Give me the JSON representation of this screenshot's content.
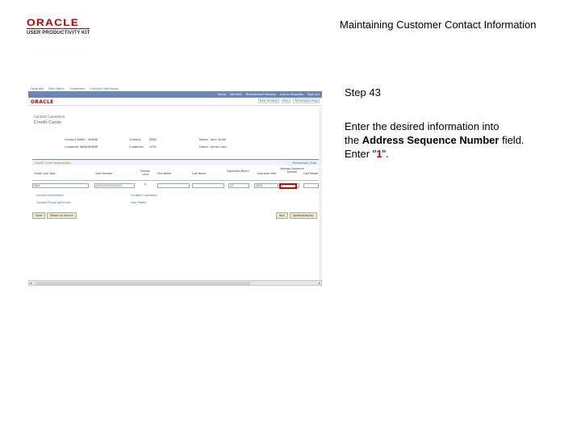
{
  "header": {
    "logo_brand": "ORACLE",
    "logo_sub": "USER PRODUCTIVITY KIT",
    "title": "Maintaining Customer Contact Information"
  },
  "instruction": {
    "step": "Step 43",
    "line1": "Enter the desired information into",
    "line2_pre": "the ",
    "field_name": "Address Sequence Number",
    "line2_post": " field.",
    "enter_pre": "Enter \"",
    "value": "1",
    "enter_post": "\"."
  },
  "screenshot": {
    "nav_top": [
      "Favorites",
      "Main Menu",
      "Customers",
      "Contact Information"
    ],
    "nav_links": [
      "Home",
      "Worklist",
      "Performance Monitor",
      "Add to Favorites",
      "Sign out"
    ],
    "brand": "ORACLE",
    "top_links": [
      "New Window",
      "Help",
      "Personalize Page"
    ],
    "breadcrumb": "Contact Customers",
    "page_title": "Credit Cards",
    "info": {
      "contact_setid_label": "Contact SetID:",
      "contact_setid": "SHARE",
      "contact_label": "Contact:",
      "contact": "NEW",
      "name_label1": "Name:",
      "name1": "John Smith",
      "customer_setid_label": "Customer SetID:",
      "customer_setid": "SHARE",
      "customer_label": "Customer:",
      "customer": "1001",
      "name_label2": "Name:",
      "name2": "Acme Corp"
    },
    "grid": {
      "title": "Credit Card Information",
      "nav": "Personalize | Find",
      "columns": [
        "Credit Card Type",
        "Card Number",
        "Primary Card",
        "First Name",
        "Last Name",
        "Expiration Month",
        "Expiration Year",
        "Address Sequence Number",
        "Card Holder"
      ],
      "row": [
        "VISA",
        "4111111111111111",
        "",
        "",
        "",
        "12",
        "2015",
        "",
        ""
      ],
      "primary": "P"
    },
    "links": [
      "Contact Information",
      "Contact Phone and Email",
      "Contact Customers",
      "User Profile"
    ],
    "buttons_left": [
      "Save",
      "Return to Search"
    ],
    "buttons_right": [
      "Add",
      "Update/Display"
    ]
  },
  "colors": {
    "accent_red": "#c00000",
    "nav_blue": "#6a85b8",
    "link_blue": "#3a5f9a"
  }
}
